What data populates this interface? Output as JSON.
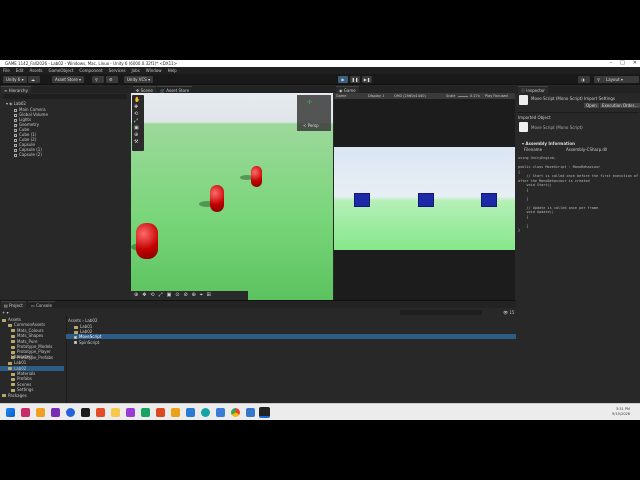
{
  "window": {
    "title": "GAME 1142_Fall2026 - Lab02 - Windows, Mac, Linux - Unity 6 (6000.0.32f1)* <DX11>"
  },
  "menu": [
    "File",
    "Edit",
    "Assets",
    "GameObject",
    "Component",
    "Services",
    "Jobs",
    "Window",
    "Help"
  ],
  "toolbar": {
    "account": "Unity 6",
    "cloud": "",
    "assetstore": "Asset Store",
    "version_control": "Unity VCS",
    "layers": "",
    "layout": "Layout"
  },
  "hierarchy": {
    "tab": "Hierarchy",
    "scene": "Lab02",
    "items": [
      "Main Camera",
      "Global Volume",
      "Lights",
      "Geometry",
      "Cube",
      "Cube (1)",
      "Cube (2)",
      "Capsule",
      "Capsule (1)",
      "Capsule (2)"
    ]
  },
  "scene": {
    "tab_scene": "Scene",
    "tab_store": "Asset Store",
    "gizmo_label": "< Persp"
  },
  "game": {
    "tab": "Game",
    "game_mode": "Game",
    "display": "Display 1",
    "resolution": "QHD (2560x1440)",
    "scale_label": "Scale",
    "scale_value": "0.27x",
    "play_focused": "Play Focused"
  },
  "inspector": {
    "tab": "Inspector",
    "title": "Move Script (Mono Script) Import Settings",
    "open_btn": "Open",
    "exec_btn": "Execution Order...",
    "imported_object": "Imported Object",
    "asset_title": "Move Script (Mono Script)",
    "assembly_info": "Assembly Information",
    "filename_label": "Filename",
    "filename_value": "Assembly-CSharp.dll",
    "code": [
      "using UnityEngine;",
      "",
      "public class MoveScript : MonoBehaviour",
      "{",
      "    // Start is called once before the first execution of Update",
      "after the MonoBehaviour is created",
      "    void Start()",
      "    {",
      "",
      "    }",
      "",
      "    // Update is called once per frame",
      "    void Update()",
      "    {",
      "",
      "    }",
      "}"
    ],
    "asset_labels": "Asset Labels"
  },
  "project": {
    "tab_project": "Project",
    "tab_console": "Console",
    "tree": [
      "Assets",
      "CommonAssets",
      "Mats_Colours",
      "Mats_Shapes",
      "Mats_Pure",
      "Prototype_Models",
      "Prototype_Player Characters",
      "Prototype_Prefabs",
      "Lab01",
      "Lab02",
      "Materials",
      "Prefabs",
      "Scenes",
      "Settings",
      "Packages"
    ],
    "breadcrumb": [
      "Assets",
      "Lab02"
    ],
    "files": [
      "Lab01",
      "Lab02",
      "MoveScript",
      "SpinScript"
    ],
    "selected_file": "MoveScript",
    "status_path": "Assets/Lab02/MoveScript.cs",
    "search_count": "15"
  },
  "taskbar": {
    "time": "3:31 PM",
    "date": "9/15/2026"
  },
  "colors": {
    "accent": "#2c5d87",
    "capsule_red": "#d10000",
    "cube_blue": "#1c2aa8",
    "ground_green": "#79d67a"
  }
}
